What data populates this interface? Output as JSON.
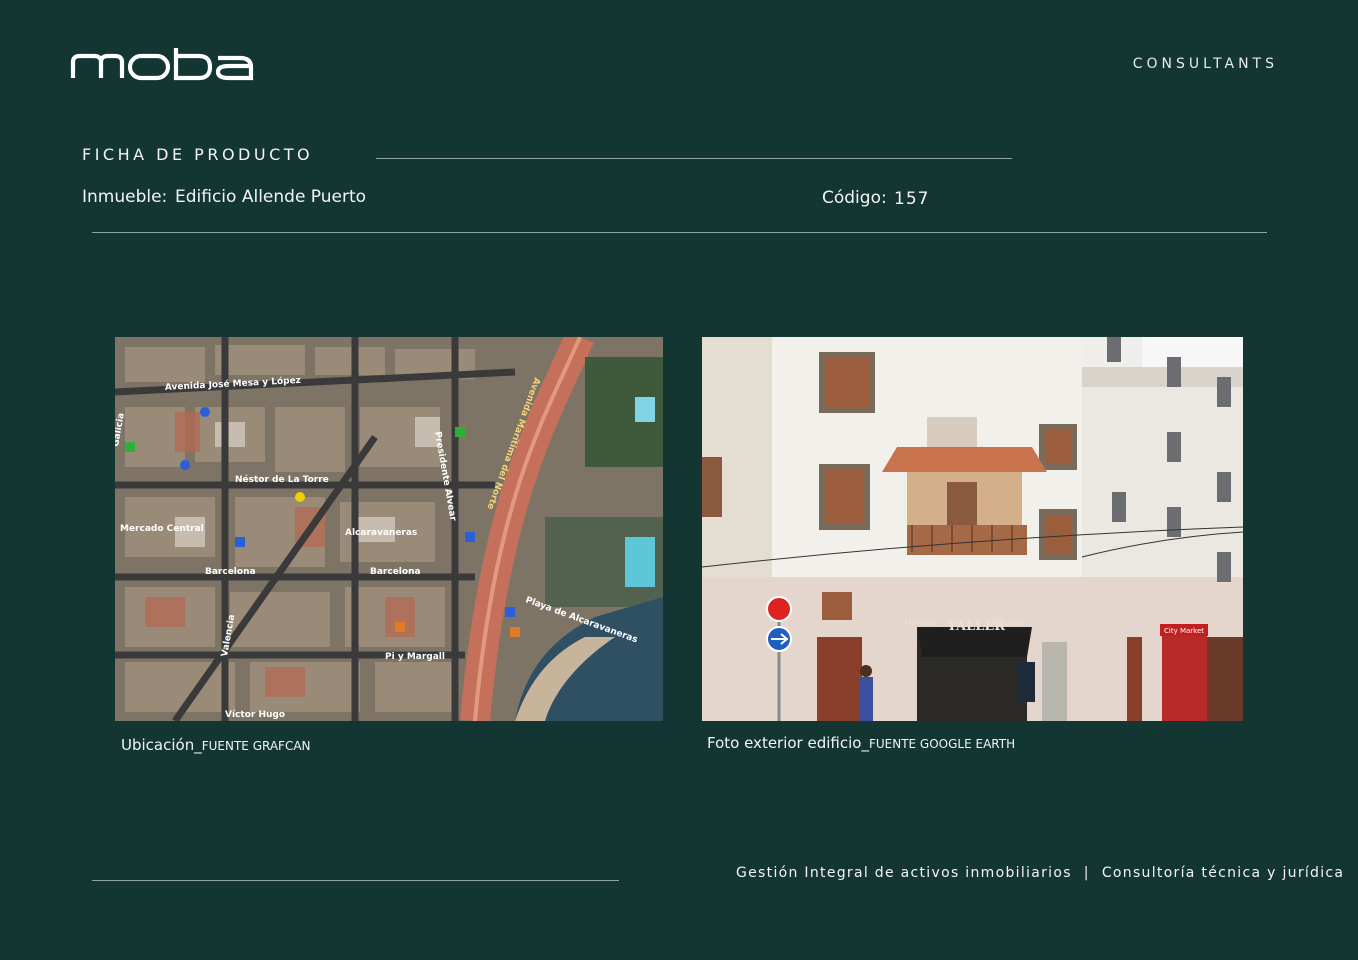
{
  "header": {
    "logo_text": "moba",
    "tagline": "CONSULTANTS"
  },
  "sheet": {
    "title": "FICHA DE PRODUCTO",
    "property_label": "Inmueble:",
    "property_value": "Edificio Allende Puerto",
    "code_label": "Código:",
    "code_value": "157"
  },
  "figures": {
    "map": {
      "caption": "Ubicación_",
      "source": "FUENTE GRAFCAN",
      "street_labels": [
        "Avenida José Mesa y López",
        "Néstor de La Torre",
        "Barcelona",
        "Presidente Alvear",
        "Avenida Marítima del Norte",
        "Playa de Alcaravaneras",
        "Víctor Hugo",
        "Pi y Margall",
        "Valencia",
        "Galicia",
        "Mercado Central",
        "Alcaravaneras"
      ],
      "icon": "aerial-map-icon"
    },
    "photo": {
      "caption": "Foto exterior edificio_",
      "source": "FUENTE GOOGLE EARTH",
      "sign_labels": [
        "Allende",
        "TALLER",
        "Allende",
        "City Market"
      ],
      "icon": "building-photo-icon"
    }
  },
  "footer": {
    "left": "Gestión Integral de activos inmobiliarios",
    "separator": "|",
    "right": "Consultoría técnica y jurídica"
  },
  "colors": {
    "background": "#143632",
    "text": "#f2f5f4",
    "rule": "#8fa5a0"
  }
}
